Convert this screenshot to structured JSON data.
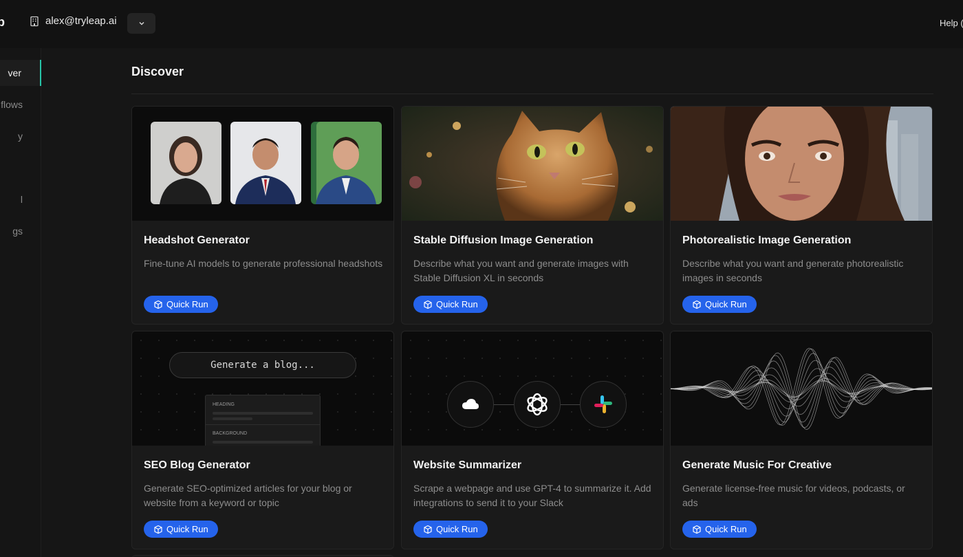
{
  "topbar": {
    "logo_fragment": "p",
    "org_email": "alex@tryleap.ai",
    "help_label": "Help ("
  },
  "sidebar": {
    "items": [
      {
        "label": "ver",
        "active": true
      },
      {
        "label": "flows",
        "active": false
      },
      {
        "label": "y",
        "active": false
      },
      {
        "label": "",
        "active": false
      },
      {
        "label": "l",
        "active": false
      },
      {
        "label": "gs",
        "active": false
      }
    ]
  },
  "main": {
    "title": "Discover",
    "cards": [
      {
        "title": "Headshot Generator",
        "description": "Fine-tune AI models to generate professional headshots",
        "button": "Quick Run"
      },
      {
        "title": "Stable Diffusion Image Generation",
        "description": "Describe what you want and generate images with Stable Diffusion XL in seconds",
        "button": "Quick Run"
      },
      {
        "title": "Photorealistic Image Generation",
        "description": "Describe what you want and generate photorealistic images in seconds",
        "button": "Quick Run"
      },
      {
        "title": "SEO Blog Generator",
        "description": "Generate SEO-optimized articles for your blog or website from a keyword or topic",
        "button": "Quick Run",
        "thumb_input": "Generate a blog...",
        "thumb_heading": "HEADING",
        "thumb_background": "BACKGROUND"
      },
      {
        "title": "Website Summarizer",
        "description": "Scrape a webpage and use GPT-4 to summarize it. Add integrations to send it to your Slack",
        "button": "Quick Run"
      },
      {
        "title": "Generate Music For Creative",
        "description": "Generate license-free music for videos, podcasts, or ads",
        "button": "Quick Run"
      }
    ]
  },
  "colors": {
    "accent_active": "#27c4a8",
    "button_blue": "#2563eb",
    "background": "#161616"
  }
}
